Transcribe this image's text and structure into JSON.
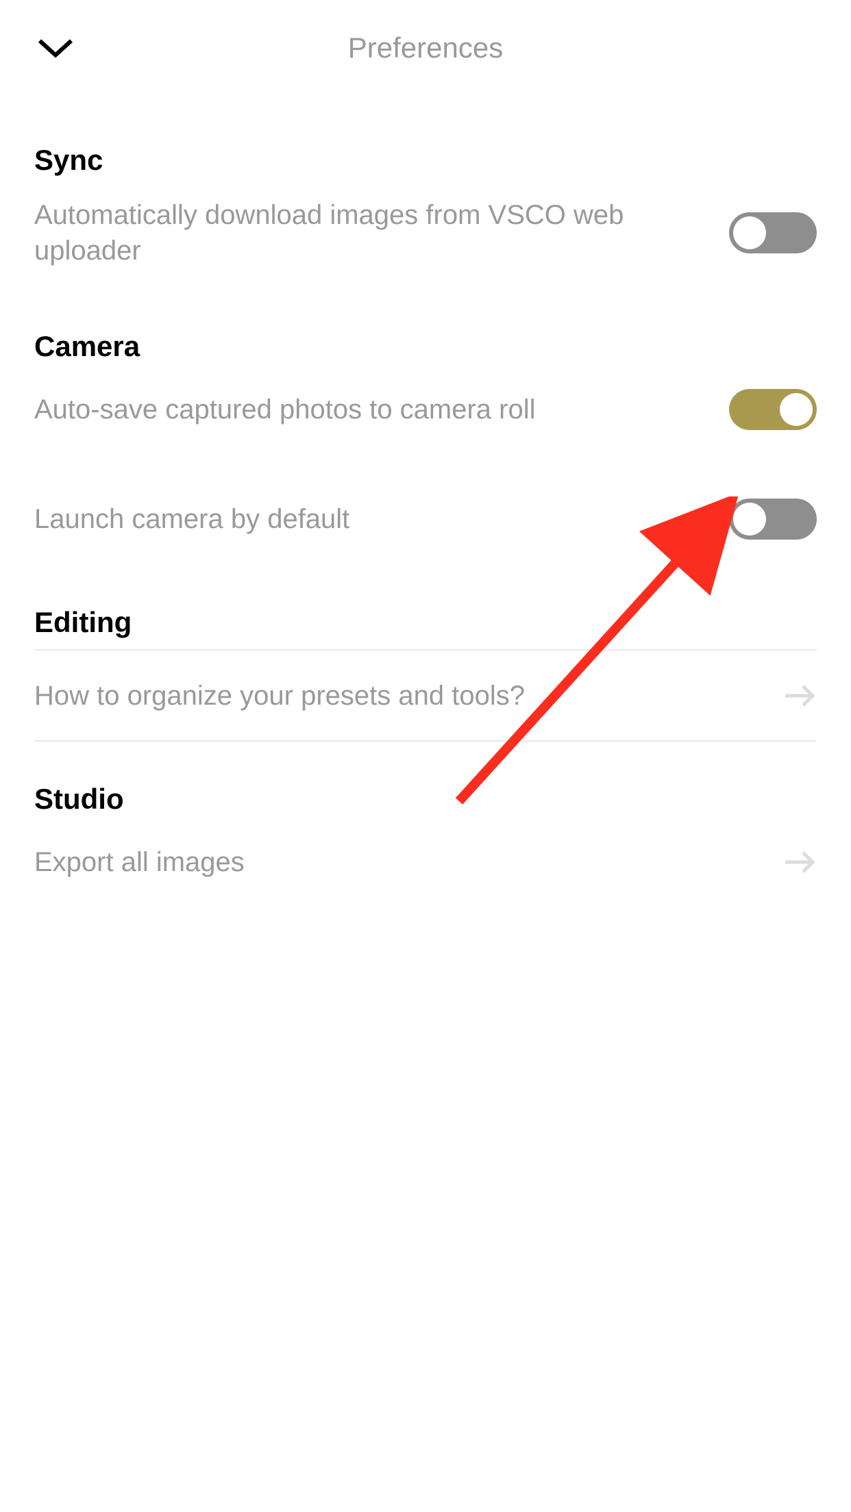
{
  "header": {
    "title": "Preferences"
  },
  "sections": {
    "sync": {
      "title": "Sync",
      "auto_download": {
        "label": "Automatically download images from VSCO web uploader",
        "state": "off"
      }
    },
    "camera": {
      "title": "Camera",
      "auto_save": {
        "label": "Auto-save captured photos to camera roll",
        "state": "on"
      },
      "launch_default": {
        "label": "Launch camera by default",
        "state": "off"
      }
    },
    "editing": {
      "title": "Editing",
      "organize_presets": {
        "label": "How to organize your presets and tools?"
      }
    },
    "studio": {
      "title": "Studio",
      "export_all": {
        "label": "Export all images"
      }
    }
  },
  "colors": {
    "toggle_on": "#a8994f",
    "toggle_off": "#8e8e8e",
    "text_primary": "#000000",
    "text_secondary": "#999999",
    "annotation": "#fb2d1f"
  }
}
